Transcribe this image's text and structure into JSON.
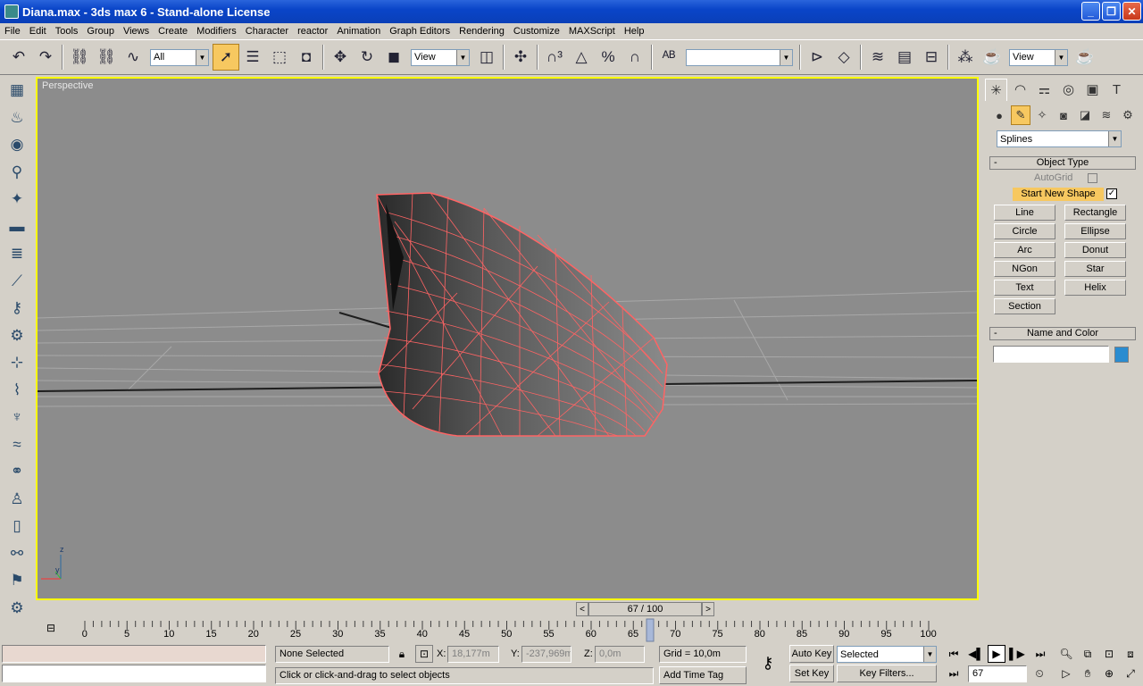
{
  "window": {
    "title": "Diana.max - 3ds max 6 - Stand-alone License",
    "min": "_",
    "max": "❐",
    "close": "✕"
  },
  "menu": [
    "File",
    "Edit",
    "Tools",
    "Group",
    "Views",
    "Create",
    "Modifiers",
    "Character",
    "reactor",
    "Animation",
    "Graph Editors",
    "Rendering",
    "Customize",
    "MAXScript",
    "Help"
  ],
  "toolbar": {
    "selection_filter": "All",
    "ref_coord": "View",
    "named_selection": "",
    "render_view": "View"
  },
  "viewport": {
    "label": "Perspective"
  },
  "command_panel": {
    "category": "Splines",
    "object_type": {
      "title": "Object Type",
      "autogrid": "AutoGrid",
      "start_new_shape": "Start New Shape",
      "buttons": [
        "Line",
        "Rectangle",
        "Circle",
        "Ellipse",
        "Arc",
        "Donut",
        "NGon",
        "Star",
        "Text",
        "Helix",
        "Section"
      ]
    },
    "name_color": {
      "title": "Name and Color",
      "name": "",
      "color": "#2a8cd0"
    }
  },
  "time_slider": {
    "label": "67 / 100",
    "prev": "<",
    "next": ">"
  },
  "trackbar": {
    "ticks": [
      "0",
      "5",
      "10",
      "15",
      "20",
      "25",
      "30",
      "35",
      "40",
      "45",
      "50",
      "55",
      "60",
      "65",
      "70",
      "75",
      "80",
      "85",
      "90",
      "95",
      "100"
    ]
  },
  "status": {
    "selection": "None Selected",
    "x_label": "X:",
    "x": "18,177m",
    "y_label": "Y:",
    "y": "-237,969m",
    "z_label": "Z:",
    "z": "0,0m",
    "grid": "Grid = 10,0m",
    "prompt": "Click or click-and-drag to select objects",
    "add_time_tag": "Add Time Tag",
    "auto_key": "Auto Key",
    "set_key": "Set Key",
    "key_mode": "Selected",
    "key_filters": "Key Filters...",
    "frame": "67"
  },
  "colors": {
    "viewport_border": "#ffff00",
    "viewport_bg": "#8c8c8c",
    "mesh_wire": "#ff6464",
    "active_tool": "#f7c860"
  }
}
